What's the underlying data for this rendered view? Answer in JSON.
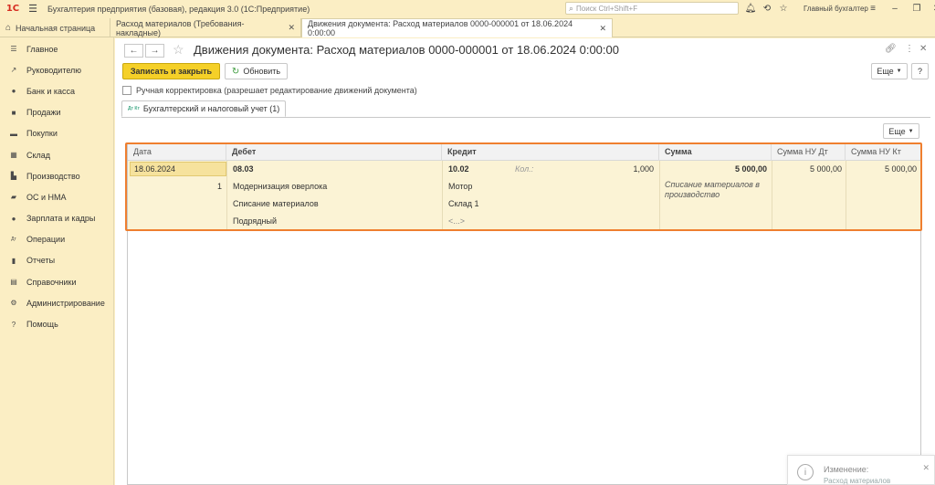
{
  "titlebar": {
    "logo": "1С",
    "app_title": "Бухгалтерия предприятия (базовая), редакция 3.0  (1С:Предприятие)",
    "search_placeholder": "Поиск Ctrl+Shift+F",
    "user": "Главный бухгалтер",
    "icons": [
      "bell-icon",
      "history-icon",
      "star-icon",
      "settings-menu-icon",
      "minimize-icon",
      "restore-icon",
      "close-icon"
    ]
  },
  "tabs": {
    "home": "Начальная страница",
    "items": [
      {
        "label": "Расход материалов (Требования-накладные)"
      },
      {
        "label": "Движения документа: Расход материалов 0000-000001 от 18.06.2024 0:00:00"
      }
    ]
  },
  "sidebar": {
    "items": [
      {
        "label": "Главное",
        "icon": "menu-icon"
      },
      {
        "label": "Руководителю",
        "icon": "trend-icon"
      },
      {
        "label": "Банк и касса",
        "icon": "coins-icon"
      },
      {
        "label": "Продажи",
        "icon": "bag-icon"
      },
      {
        "label": "Покупки",
        "icon": "cart-icon"
      },
      {
        "label": "Склад",
        "icon": "warehouse-icon"
      },
      {
        "label": "Производство",
        "icon": "factory-icon"
      },
      {
        "label": "ОС и НМА",
        "icon": "truck-icon"
      },
      {
        "label": "Зарплата и кадры",
        "icon": "person-icon"
      },
      {
        "label": "Операции",
        "icon": "dt-kt-icon"
      },
      {
        "label": "Отчеты",
        "icon": "bar-chart-icon"
      },
      {
        "label": "Справочники",
        "icon": "book-icon"
      },
      {
        "label": "Администрирование",
        "icon": "gear-icon"
      },
      {
        "label": "Помощь",
        "icon": "question-icon"
      }
    ]
  },
  "doc": {
    "title": "Движения документа: Расход материалов 0000-000001 от 18.06.2024 0:00:00",
    "save_close": "Записать и закрыть",
    "refresh": "Обновить",
    "more": "Еще",
    "help": "?",
    "manual_correction": "Ручная корректировка (разрешает редактирование движений документа)",
    "subtab_icon": "Дт Кт",
    "subtab": "Бухгалтерский и налоговый учет (1)",
    "grid_more": "Еще"
  },
  "grid": {
    "headers": {
      "date": "Дата",
      "debit": "Дебет",
      "credit": "Кредит",
      "sum": "Сумма",
      "sum_nu_dt": "Сумма НУ Дт",
      "sum_nu_kt": "Сумма НУ Кт"
    },
    "row": {
      "date": "18.06.2024",
      "number": "1",
      "debit_account": "08.03",
      "debit_sub1": "Модернизация оверлока",
      "debit_sub2": "Списание материалов",
      "debit_sub3": "Подрядный",
      "credit_account": "10.02",
      "qty_label": "Кол.:",
      "qty": "1,000",
      "credit_sub1": "Мотор",
      "credit_sub2": "Склад 1",
      "credit_sub3": "<...>",
      "sum": "5 000,00",
      "content": "Списание материалов в производство",
      "sum_nu_dt": "5 000,00",
      "sum_nu_kt": "5 000,00"
    }
  },
  "notification": {
    "title": "Изменение:",
    "subtitle": "Расход материалов"
  },
  "colors": {
    "accent_yellow": "#f5d028",
    "panel_bg": "#fbeec4",
    "highlight_border": "#ef7f2f",
    "row_bg": "#fbf3d5"
  }
}
